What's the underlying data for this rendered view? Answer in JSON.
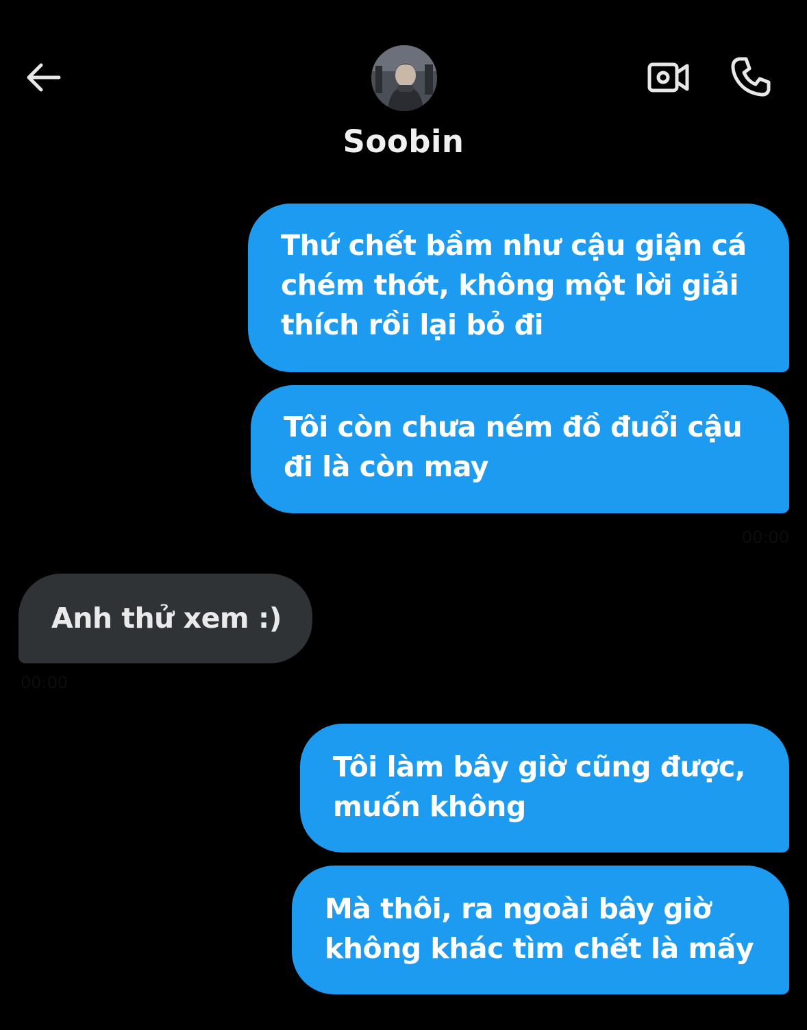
{
  "header": {
    "back_icon": "arrow-left-icon",
    "video_icon": "video-camera-icon",
    "phone_icon": "phone-icon",
    "contact_name": "Soobin"
  },
  "messages": [
    {
      "direction": "outgoing",
      "text": "Thứ chết bầm như cậu giận cá chém thớt, không một lời giải thích rồi lại bỏ đi"
    },
    {
      "direction": "outgoing",
      "text": "Tôi còn chưa ném đồ đuổi cậu đi là còn may",
      "time": "00:00"
    },
    {
      "direction": "incoming",
      "text": "Anh thử xem :)",
      "time": "00:00"
    },
    {
      "direction": "outgoing",
      "text": "Tôi làm bây giờ cũng được, muốn không"
    },
    {
      "direction": "outgoing",
      "text": "Mà thôi, ra ngoài bây giờ không khác tìm chết là mấy"
    }
  ],
  "colors": {
    "background": "#000000",
    "outgoing_bubble": "#1d9bf0",
    "incoming_bubble": "#2f3336",
    "text": "#ffffff"
  }
}
